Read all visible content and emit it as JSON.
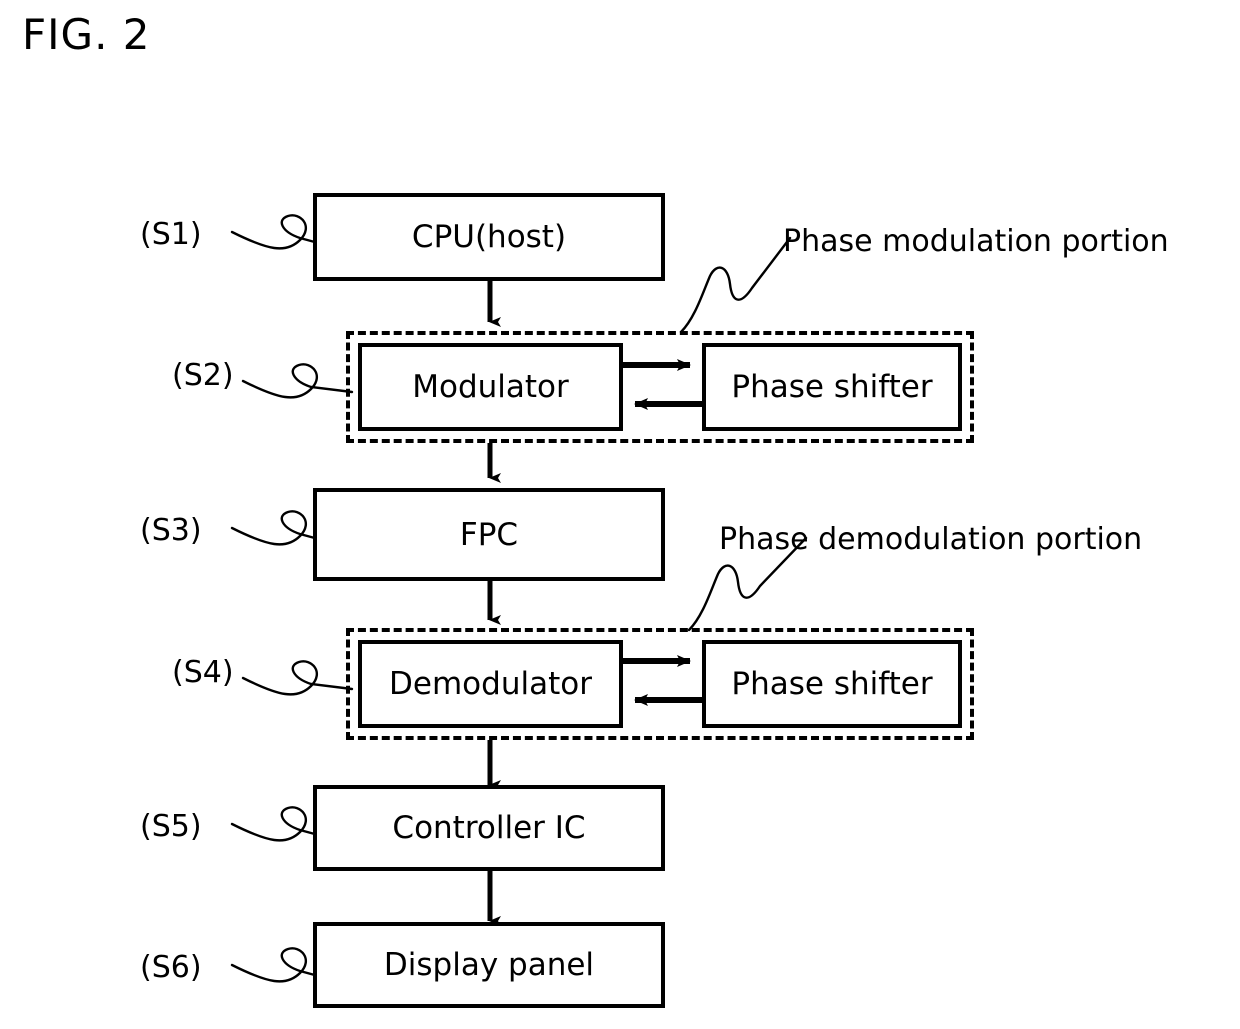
{
  "figure": {
    "title": "FIG. 2",
    "type": "block-flow-diagram"
  },
  "nodes": [
    {
      "id": "cpu",
      "label": "CPU(host)",
      "step": "(S1)"
    },
    {
      "id": "modulator",
      "label": "Modulator",
      "step": "(S2)"
    },
    {
      "id": "phase_shifter_1",
      "label": "Phase shifter",
      "step": ""
    },
    {
      "id": "fpc",
      "label": "FPC",
      "step": "(S3)"
    },
    {
      "id": "demodulator",
      "label": "Demodulator",
      "step": "(S4)"
    },
    {
      "id": "phase_shifter_2",
      "label": "Phase shifter",
      "step": ""
    },
    {
      "id": "controller_ic",
      "label": "Controller IC",
      "step": "(S5)"
    },
    {
      "id": "display_panel",
      "label": "Display panel",
      "step": "(S6)"
    }
  ],
  "groups": [
    {
      "id": "phase_modulation",
      "caption": "Phase modulation portion"
    },
    {
      "id": "phase_demodulation",
      "caption": "Phase demodulation portion"
    }
  ],
  "steps": {
    "s1": "(S1)",
    "s2": "(S2)",
    "s3": "(S3)",
    "s4": "(S4)",
    "s5": "(S5)",
    "s6": "(S6)"
  },
  "labels": {
    "cpu": "CPU(host)",
    "modulator": "Modulator",
    "phase_shifter_top": "Phase shifter",
    "fpc": "FPC",
    "demodulator": "Demodulator",
    "phase_shifter_bottom": "Phase shifter",
    "controller_ic": "Controller IC",
    "display_panel": "Display panel",
    "phase_modulation_portion": "Phase modulation portion",
    "phase_demodulation_portion": "Phase demodulation portion"
  },
  "colors": {
    "stroke": "#000000",
    "background": "#ffffff"
  }
}
